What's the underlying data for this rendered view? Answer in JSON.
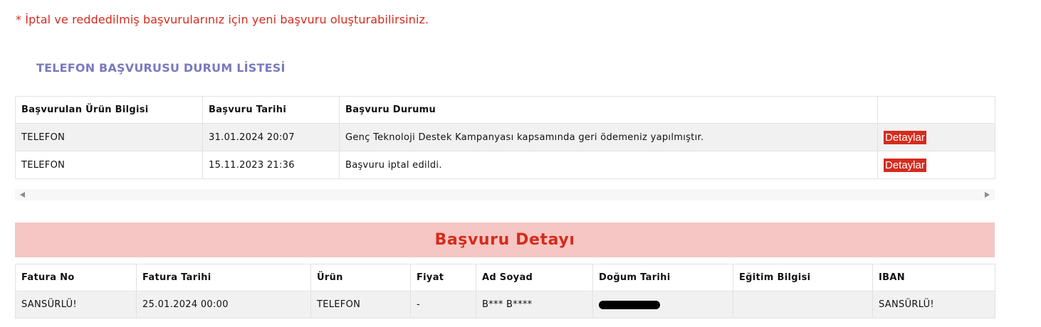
{
  "notice": "* İptal ve reddedilmiş başvurularınız için yeni başvuru oluşturabilirsiniz.",
  "status_list": {
    "title": "TELEFON BAŞVURUSU DURUM LİSTESİ",
    "columns": [
      "Başvurulan Ürün Bilgisi",
      "Başvuru Tarihi",
      "Başvuru Durumu",
      ""
    ],
    "rows": [
      {
        "product": "TELEFON",
        "date": "31.01.2024 20:07",
        "status": "Genç Teknoloji Destek Kampanyası kapsamında geri ödemeniz yapılmıştır.",
        "action": "Detaylar"
      },
      {
        "product": "TELEFON",
        "date": "15.11.2023 21:36",
        "status": "Başvuru iptal edildi.",
        "action": "Detaylar"
      }
    ]
  },
  "detail": {
    "title": "Başvuru Detayı",
    "columns": [
      "Fatura No",
      "Fatura Tarihi",
      "Ürün",
      "Fiyat",
      "Ad Soyad",
      "Doğum Tarihi",
      "Eğitim Bilgisi",
      "IBAN"
    ],
    "row": {
      "invoice_no": "SANSÜRLÜ!",
      "invoice_date": "25.01.2024 00:00",
      "product": "TELEFON",
      "price": "-",
      "name": "B*** B****",
      "birth_date": "",
      "education": "",
      "iban": "SANSÜRLÜ!"
    }
  },
  "colors": {
    "accent_red": "#d52b1e",
    "title_purple": "#7a79c0",
    "detail_header_bg": "#f5c6c3"
  },
  "icons": [
    "scroll-left-arrow-icon",
    "scroll-right-arrow-icon"
  ]
}
